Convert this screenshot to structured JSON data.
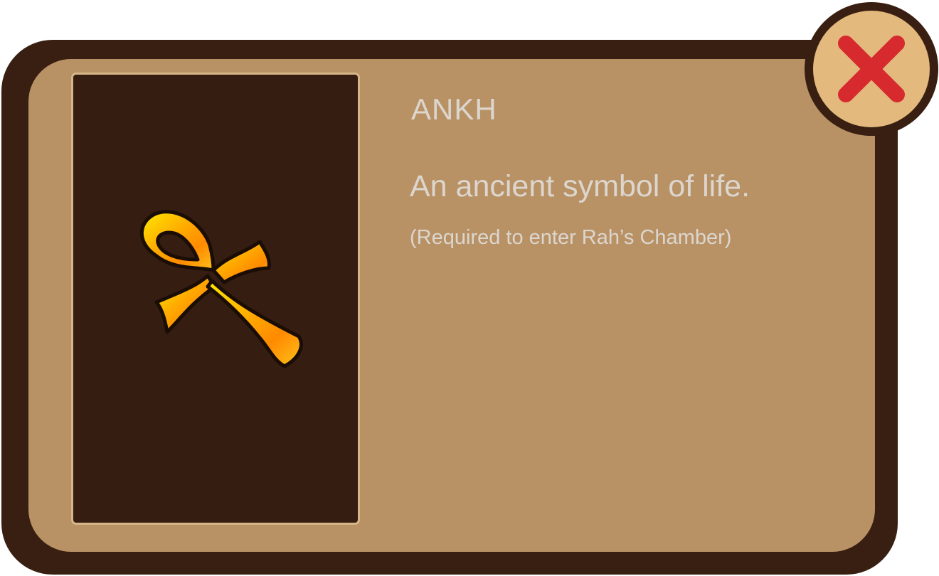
{
  "dialog": {
    "title": "ANKH",
    "description": "An ancient symbol of life.",
    "note": "(Required to enter Rah’s Chamber)"
  },
  "item": {
    "icon": "ankh-icon"
  },
  "close_button": {
    "icon": "close-icon"
  },
  "colors": {
    "frame": "#391f11",
    "panel": "#b89265",
    "card": "#361d12",
    "card_border": "#d6b688",
    "text": "#dcd6cf",
    "close_bg": "#e3b97d",
    "close_x": "#d72a2e",
    "ankh_light": "#ffe800",
    "ankh_dark": "#ff8a00"
  }
}
